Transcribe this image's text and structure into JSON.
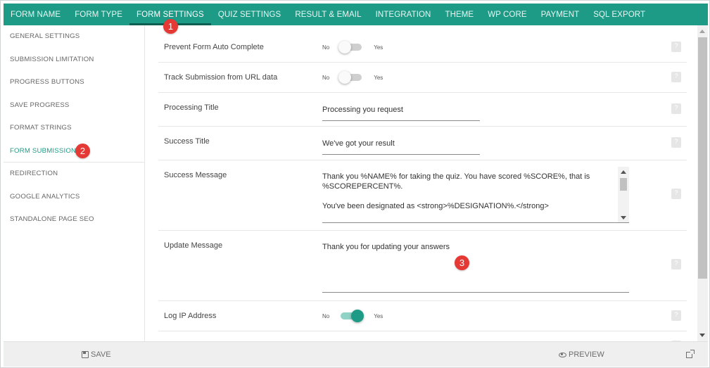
{
  "nav": {
    "tabs": [
      {
        "label": "FORM NAME"
      },
      {
        "label": "FORM TYPE"
      },
      {
        "label": "FORM SETTINGS"
      },
      {
        "label": "QUIZ SETTINGS"
      },
      {
        "label": "RESULT & EMAIL"
      },
      {
        "label": "INTEGRATION"
      },
      {
        "label": "THEME"
      },
      {
        "label": "WP CORE"
      },
      {
        "label": "PAYMENT"
      },
      {
        "label": "SQL EXPORT"
      }
    ],
    "active": "FORM SETTINGS"
  },
  "sidebar": {
    "items": [
      {
        "label": "GENERAL SETTINGS"
      },
      {
        "label": "SUBMISSION LIMITATION"
      },
      {
        "label": "PROGRESS BUTTONS"
      },
      {
        "label": "SAVE PROGRESS"
      },
      {
        "label": "FORMAT STRINGS"
      },
      {
        "label": "FORM SUBMISSION"
      },
      {
        "label": "REDIRECTION"
      },
      {
        "label": "GOOGLE ANALYTICS"
      },
      {
        "label": "STANDALONE PAGE SEO"
      }
    ],
    "active": "FORM SUBMISSION"
  },
  "settings": {
    "prevent_autocomplete": {
      "label": "Prevent Form Auto Complete",
      "no": "No",
      "yes": "Yes",
      "enabled": false
    },
    "track_url": {
      "label": "Track Submission from URL data",
      "no": "No",
      "yes": "Yes",
      "enabled": false
    },
    "processing_title": {
      "label": "Processing Title",
      "value": "Processing you request"
    },
    "success_title": {
      "label": "Success Title",
      "value": "We've got your result"
    },
    "success_message": {
      "label": "Success Message",
      "line1": "Thank you %NAME% for taking the quiz. You have scored %SCORE%, that is",
      "line2": "%SCOREPERCENT%.",
      "line3": "You've been designated as <strong>%DESIGNATION%.</strong>"
    },
    "update_message": {
      "label": "Update Message",
      "value": "Thank you for updating your answers"
    },
    "log_ip": {
      "label": "Log IP Address",
      "no": "No",
      "yes": "Yes",
      "enabled": true
    }
  },
  "footer": {
    "save_label": "SAVE",
    "preview_label": "PREVIEW"
  },
  "callouts": [
    "1",
    "2",
    "3"
  ],
  "colors": {
    "brand": "#1d9b86",
    "callout": "#e53935",
    "footer_bg": "#efefef"
  },
  "icons": {
    "save": "floppy-disk-icon",
    "preview": "eye-icon",
    "external": "external-link-icon",
    "help": "question-mark-icon"
  }
}
